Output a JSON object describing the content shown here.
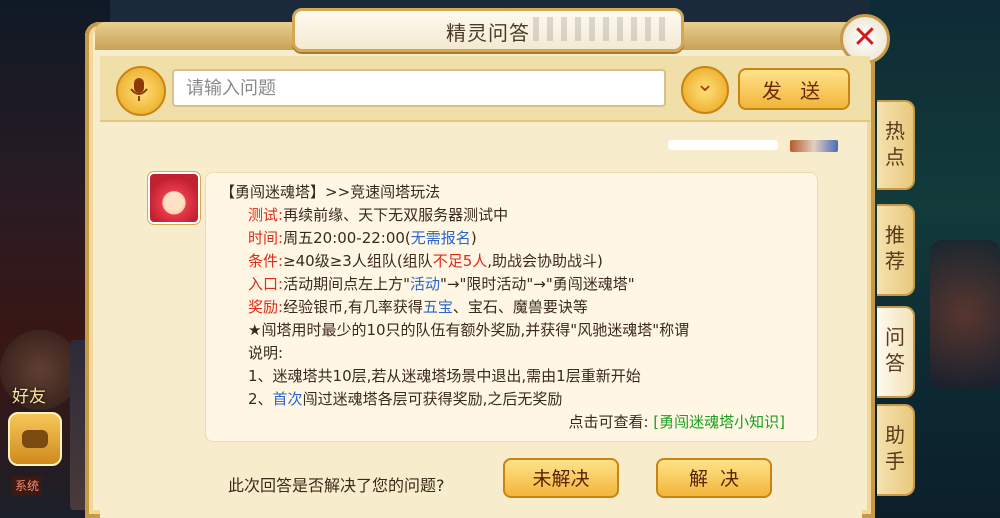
{
  "window": {
    "title": "精灵问答"
  },
  "background": {
    "friend_label": "好友",
    "ticker": "系统"
  },
  "search": {
    "placeholder": "请输入问题"
  },
  "toolbar": {
    "send_label": "发 送",
    "dropdown_icon": "chevron-down-icon",
    "mic_icon": "microphone-icon"
  },
  "side_tabs": [
    {
      "label": "热点",
      "chars": [
        "热",
        "点"
      ]
    },
    {
      "label": "推荐",
      "chars": [
        "推",
        "荐"
      ]
    },
    {
      "label": "问答",
      "chars": [
        "问",
        "答"
      ],
      "active": true
    },
    {
      "label": "助手",
      "chars": [
        "助",
        "手"
      ]
    }
  ],
  "answer": {
    "heading": "【勇闯迷魂塔】>>竞速闯塔玩法",
    "test": {
      "key": "测试:",
      "value": "再续前缘、天下无双服务器测试中"
    },
    "time": {
      "key": "时间:",
      "value": "周五20:00-22:00(",
      "note": "无需报名",
      "close": ")"
    },
    "condition": {
      "key": "条件:",
      "part1": "≥40级≥3人组队(组队",
      "red": "不足5人",
      "part2": ",助战会协助战斗)"
    },
    "entry": {
      "key": "入口:",
      "part1": "活动期间点左上方\"",
      "blue": "活动",
      "part2": "\"→\"限时活动\"→\"勇闯迷魂塔\""
    },
    "reward": {
      "key": "奖励:",
      "part1": "经验银币,有几率获得",
      "blue": "五宝",
      "part2": "、宝石、魔兽要诀等"
    },
    "star": "★闯塔用时最少的10只的队伍有额外奖励,并获得\"风驰迷魂塔\"称谓",
    "notes_key": "说明:",
    "note1": "1、迷魂塔共10层,若从迷魂塔场景中退出,需由1层重新开始",
    "note2": {
      "prefix": "2、",
      "blue": "首次",
      "rest": "闯过迷魂塔各层可获得奖励,之后无奖励"
    },
    "link_prefix": "点击可查看:",
    "link": "[勇闯迷魂塔小知识]"
  },
  "feedback": {
    "question": "此次回答是否解决了您的问题?",
    "unsolved": "未解决",
    "solved": "解决"
  },
  "colors": {
    "accent": "#f2b53a",
    "red": "#e02a1a",
    "blue": "#2a66cc",
    "green": "#1aa020",
    "close": "#d4191c"
  }
}
